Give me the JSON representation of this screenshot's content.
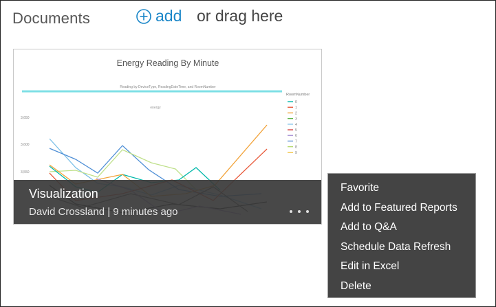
{
  "header": {
    "title": "Documents",
    "add_label": "add",
    "drag_label": "or drag here"
  },
  "tile": {
    "name": "Visualization",
    "author": "David Crossland",
    "separator": " | ",
    "time": "9 minutes ago",
    "more_label": "..."
  },
  "thumbnail": {
    "title": "Energy Reading By Minute",
    "subtitle": "Reading by DeviceType, ReadingDateTime, and RoomNumber",
    "series_label": "energy",
    "legend_title": "RoomNumber",
    "legend_items": [
      "0",
      "1",
      "2",
      "3",
      "4",
      "5",
      "6",
      "7",
      "8",
      "9"
    ],
    "legend_colors": [
      "#01b8aa",
      "#e8593a",
      "#f2a33a",
      "#5fb64a",
      "#7bc0e8",
      "#d64545",
      "#a58ed4",
      "#6c9ad8",
      "#b2d86a",
      "#f2c037"
    ],
    "y_ticks": [
      "3,650",
      "3,600",
      "3,550"
    ]
  },
  "context_menu": {
    "items": [
      "Favorite",
      "Add to Featured Reports",
      "Add to Q&A",
      "Schedule Data Refresh",
      "Edit in Excel",
      "Delete"
    ]
  },
  "colors": {
    "accent": "#1a86c8",
    "overlay": "#3a3a3a",
    "menu_bg": "#444444"
  }
}
